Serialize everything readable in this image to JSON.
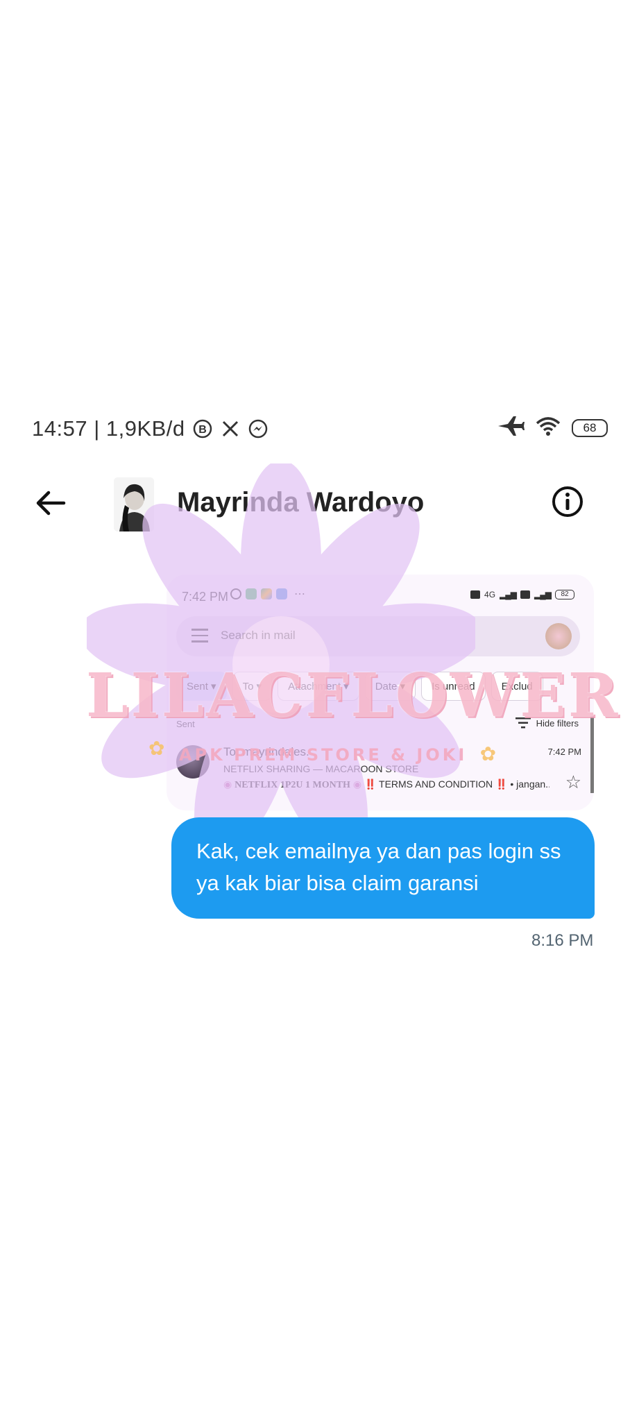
{
  "status_bar": {
    "time_speed": "14:57 | 1,9KB/d",
    "battery": "68",
    "icons": [
      "b-icon",
      "x-icon",
      "messenger-icon",
      "airplane-icon",
      "wifi-icon",
      "battery-icon"
    ]
  },
  "header": {
    "contact_name": "Mayrinda Wardoyo",
    "icons": [
      "back-arrow-icon",
      "info-icon"
    ]
  },
  "screenshot": {
    "time": "7:42 PM",
    "battery": "82",
    "network_label": "4G",
    "search_placeholder": "Search in mail",
    "chips": [
      "Sent",
      "To",
      "Attachment",
      "Date",
      "Is unread",
      "Exclud"
    ],
    "section_label": "Sent",
    "hide_filters": "Hide filters",
    "mail": {
      "to": "To: mayrindales.",
      "subject": "NETFLIX SHARING — MACAROON STORE",
      "snippet_bold": "NETFLIX 1P2U 1 MONTH",
      "snippet_rest": "‼️ TERMS AND CONDITION ‼️ • jangan...",
      "time": "7:42 PM"
    }
  },
  "watermark": {
    "title": "LILACFLOWER",
    "subtitle": "APK PREM STORE & JOKI"
  },
  "message": {
    "text": "Kak, cek emailnya ya dan pas login ss ya kak biar bisa claim garansi",
    "time": "8:16 PM"
  },
  "colors": {
    "bubble": "#1d9bf0",
    "timestamp": "#536471",
    "watermark_flower": "#e3c4f5",
    "watermark_text": "#f7b7c9"
  }
}
